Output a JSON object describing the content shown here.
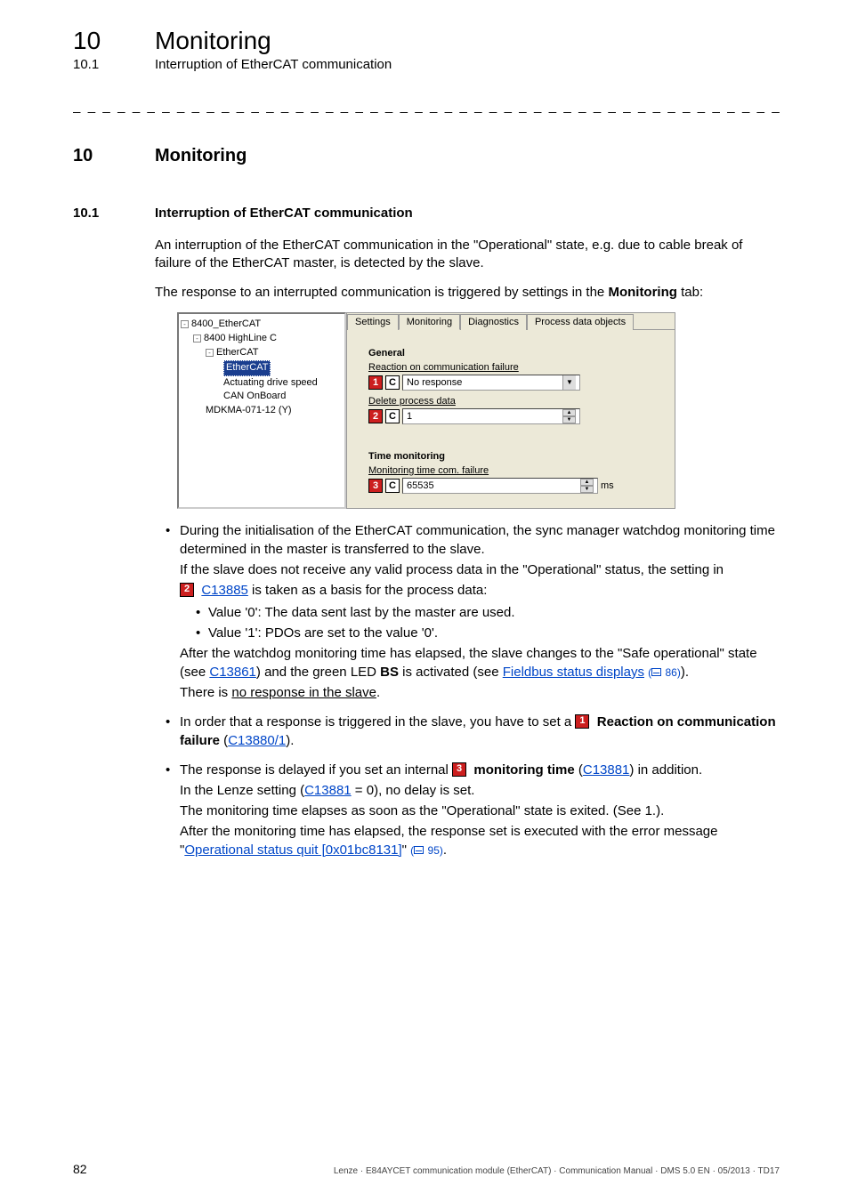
{
  "header": {
    "chapter_num": "10",
    "chapter_title": "Monitoring",
    "section_num": "10.1",
    "section_title": "Interruption of EtherCAT communication"
  },
  "heading": {
    "num": "10",
    "title": "Monitoring"
  },
  "subheading": {
    "num": "10.1",
    "title": "Interruption of EtherCAT communication"
  },
  "intro": {
    "p1": "An interruption of the EtherCAT communication in the \"Operational\" state, e.g. due to cable break of failure of the EtherCAT master, is detected by the slave.",
    "p2a": "The response to an interrupted communication is triggered by settings in the ",
    "p2b": "Monitoring",
    "p2c": " tab:"
  },
  "figure": {
    "tree": {
      "n0": "8400_EtherCAT",
      "n1": "8400 HighLine C",
      "n2": "EtherCAT",
      "n3": "EtherCAT",
      "n4": "Actuating drive speed",
      "n5": "CAN OnBoard",
      "n6": "MDKMA-071-12 (Y)"
    },
    "tabs": {
      "t1": "Settings",
      "t2": "Monitoring",
      "t3": "Diagnostics",
      "t4": "Process data objects"
    },
    "general": {
      "title": "General",
      "reaction_label": "Reaction on communication failure",
      "reaction_value": "No response",
      "delete_label": "Delete process data",
      "delete_value": "1"
    },
    "time": {
      "title": "Time monitoring",
      "mon_label": "Monitoring time com. failure",
      "mon_value": "65535",
      "mon_unit": "ms"
    },
    "marks": {
      "m1": "1",
      "m2": "2",
      "m3": "3",
      "c": "C"
    }
  },
  "bul1": {
    "p1": "During the initialisation of the EtherCAT communication, the sync manager watchdog monitoring time determined in the master is transferred to the slave.",
    "p2": "If the slave does not receive any valid process data in the \"Operational\" status, the setting in",
    "link1": "C13885",
    "p3": " is taken as a basis for the process data:",
    "sub1": "Value '0': The data sent last by the master are used.",
    "sub2": "Value '1': PDOs are set to the value '0'.",
    "p4a": "After the watchdog monitoring time has elapsed, the slave changes to the \"Safe operational\" state (see ",
    "link2": "C13861",
    "p4b": ") and the green LED ",
    "p4bold": "BS",
    "p4c": " is activated (see ",
    "link3": "Fieldbus status displays",
    "pgref1": "86",
    "p4d": ").",
    "p5a": "There is ",
    "p5u": "no response in the slave",
    "p5b": "."
  },
  "bul2": {
    "p1a": "In order that a response is triggered in the slave, you have to set a ",
    "p1bold": "Reaction on communication failure",
    "p1b": " (",
    "link1": "C13880/1",
    "p1c": ")."
  },
  "bul3": {
    "p1a": "The response is delayed if you set an internal ",
    "p1bold": "monitoring time",
    "p1b": " (",
    "link1": "C13881",
    "p1c": ") in addition.",
    "p2a": "In the Lenze setting (",
    "link2": "C13881",
    "p2b": " = 0), no delay is set.",
    "p3": "The monitoring time elapses as soon as the \"Operational\" state is exited. (See 1.).",
    "p4a": "After the monitoring time has elapsed, the response set is executed with the error message \"",
    "link3": "Operational status quit [0x01bc8131]",
    "p4b": "\" ",
    "pgref1": "95",
    "p4c": "."
  },
  "footer": {
    "page": "82",
    "line": "Lenze · E84AYCET communication module (EtherCAT) · Communication Manual · DMS 5.0 EN · 05/2013 · TD17"
  }
}
